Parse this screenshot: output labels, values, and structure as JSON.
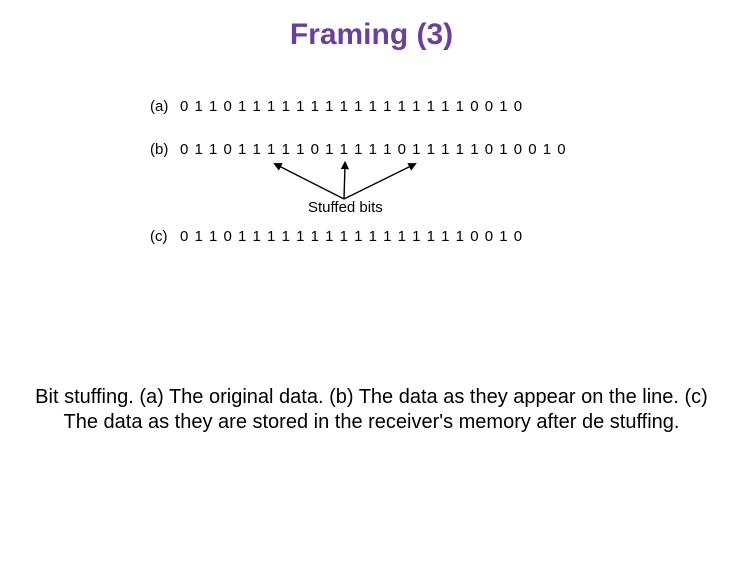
{
  "title": "Framing (3)",
  "rows": {
    "a": {
      "label": "(a)",
      "bits": "0 1 1 0 1 1 1 1 1 1 1 1 1 1 1 1 1 1 1 1 0 0 1 0"
    },
    "b": {
      "label": "(b)",
      "bits": "0 1 1 0 1 1 1 1 1 0 1 1 1 1 1 0 1 1 1 1 1 0 1 0 0 1 0"
    },
    "c": {
      "label": "(c)",
      "bits": "0 1 1 0 1 1 1 1 1 1 1 1 1 1 1 1 1 1 1 1 0 0 1 0"
    }
  },
  "stuffed_label": "Stuffed bits",
  "caption": {
    "prefix": "Bit stuffing. ",
    "a": "(a)",
    "a_text": " The original data. ",
    "b": "(b)",
    "b_text": " The data as they appear on the line. ",
    "c": "(c)",
    "c_text": " The data as they are stored in the receiver's memory after de stuffing."
  }
}
